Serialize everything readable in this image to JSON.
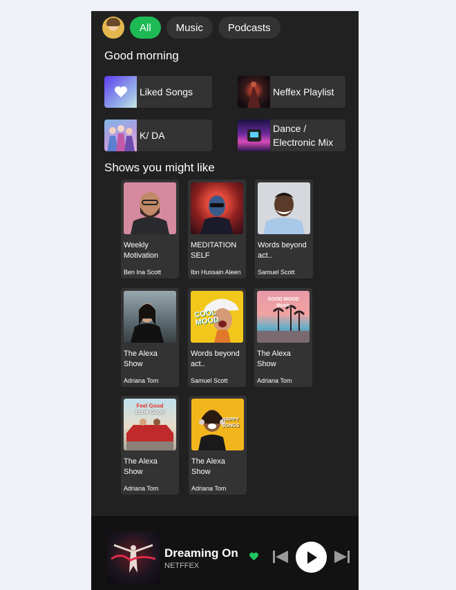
{
  "filters": [
    "All",
    "Music",
    "Podcasts"
  ],
  "greeting": "Good morning",
  "shortcuts": [
    {
      "label_lines": [
        "Liked Songs"
      ],
      "icon": "heart-icon"
    },
    {
      "label_lines": [
        "Neffex Playlist"
      ],
      "icon": "playlist-art"
    },
    {
      "label_lines": [
        "K/ DA"
      ],
      "icon": "playlist-art"
    },
    {
      "label_lines": [
        "Dance /",
        "Electronic Mix"
      ],
      "icon": "playlist-art"
    }
  ],
  "shows_title": "Shows you might like",
  "shows": [
    {
      "title_lines": [
        "Weekly",
        "Motivation"
      ],
      "author": "Ben Ina Scott"
    },
    {
      "title_lines": [
        "MEDITATION",
        "SELF"
      ],
      "author": "Ibn Hussain Aleen"
    },
    {
      "title_lines": [
        "Words beyond",
        "act.."
      ],
      "author": "Samuel Scott"
    },
    {
      "title_lines": [
        "The Alexa",
        "Show"
      ],
      "author": "Adriana Tom"
    },
    {
      "title_lines": [
        "Words beyond",
        "act.."
      ],
      "author": "Samuel Scott"
    },
    {
      "title_lines": [
        "The Alexa",
        "Show"
      ],
      "author": "Adriana Tom"
    },
    {
      "title_lines": [
        "The Alexa",
        "Show"
      ],
      "author": "Adriana Tom"
    },
    {
      "title_lines": [
        "The Alexa",
        "Show"
      ],
      "author": "Adriana Tom"
    }
  ],
  "cover_text": {
    "good_mood_1": "GOOD MOOD",
    "good_mood_2": "Music",
    "feel_good_1": "Feel Good",
    "feel_good_2": "Look Good",
    "happy_1": "HAPPY",
    "happy_2": "SONGS",
    "cool_1": "COOL",
    "cool_2": "MOOD"
  },
  "player": {
    "song": "Dreaming On",
    "artist": "NETFFEX"
  },
  "colors": {
    "accent": "#1db954",
    "background": "#212121",
    "card": "#333333",
    "player": "#121212"
  }
}
